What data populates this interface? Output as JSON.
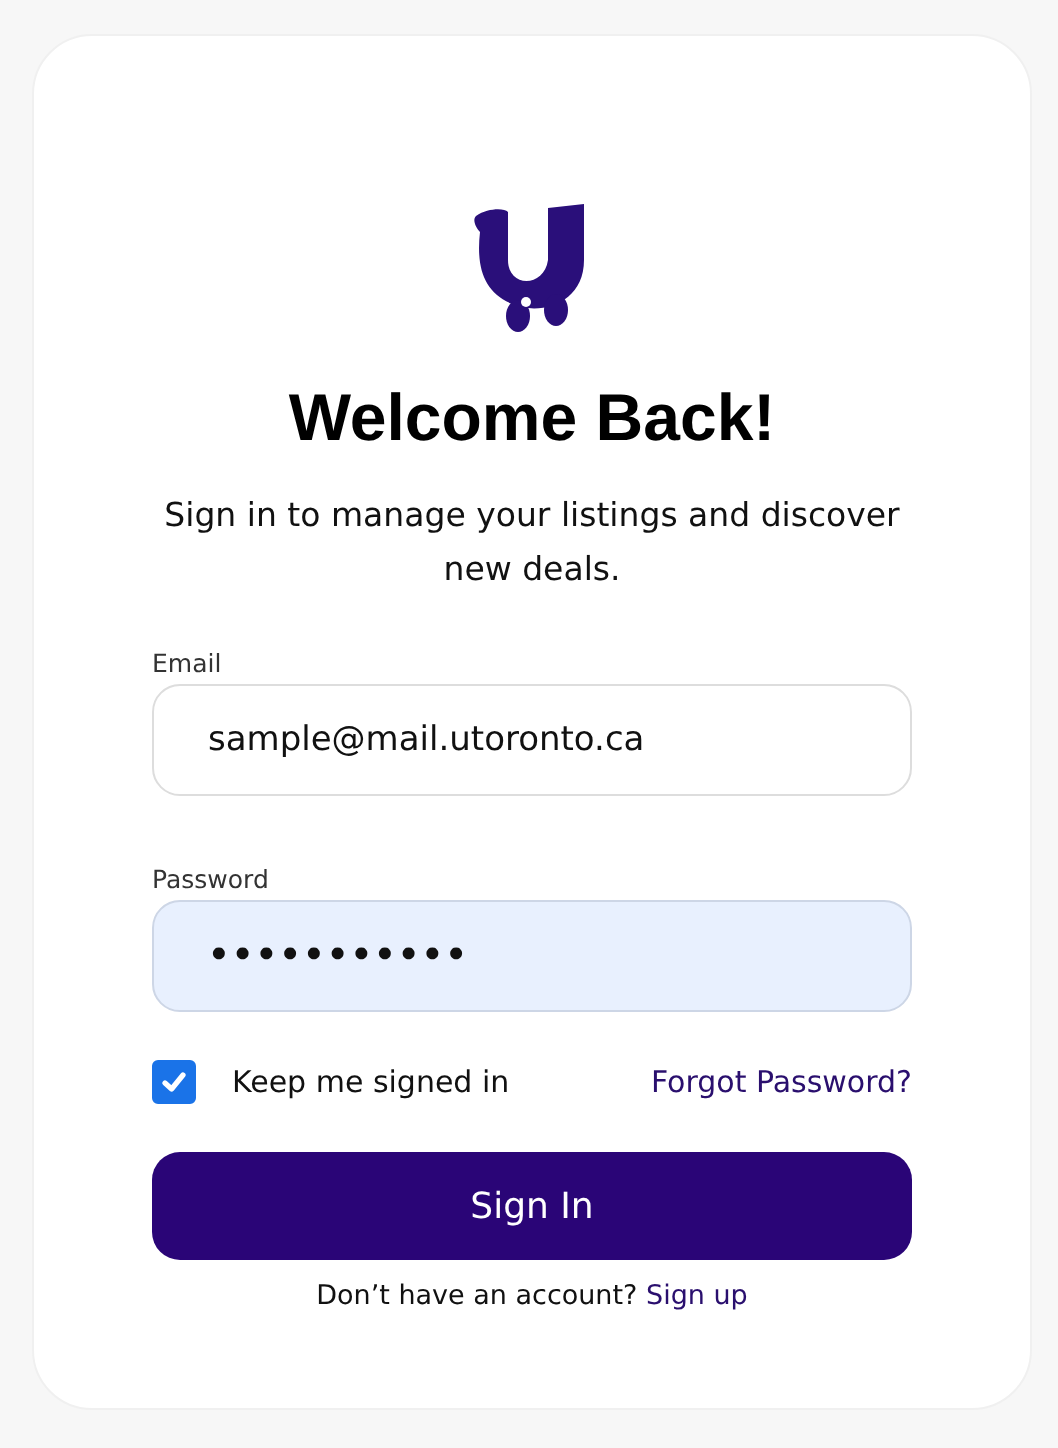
{
  "title": "Welcome Back!",
  "subtitle": "Sign in to manage your listings and discover new deals.",
  "fields": [
    {
      "label": "Email",
      "value": "sample@mail.utoronto.ca",
      "kind": "email"
    },
    {
      "label": "Password",
      "value": "•••••••••••",
      "kind": "password"
    }
  ],
  "remember": {
    "label": "Keep me signed in",
    "checked": true
  },
  "forgot_link": "Forgot Password?",
  "submit_button": "Sign In",
  "signup": {
    "prompt": "Don’t have an account?",
    "link": "Sign up"
  }
}
